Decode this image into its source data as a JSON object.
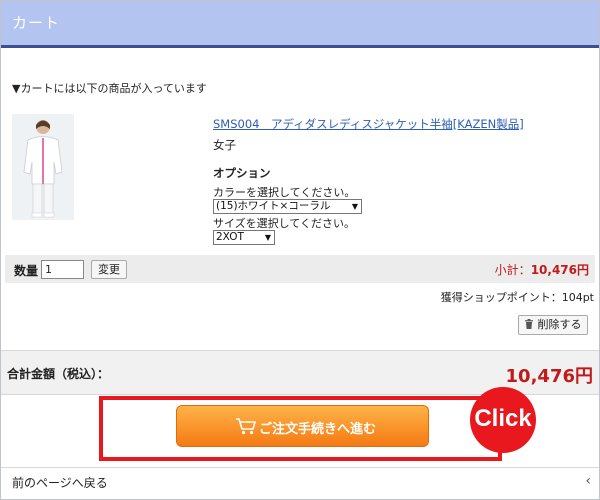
{
  "header": {
    "title": "カート"
  },
  "cart": {
    "intro": "▼カートには以下の商品が入っています",
    "item": {
      "name": "SMS004　アディダスレディスジャケット半袖[KAZEN製品]",
      "gender": "女子",
      "options_title": "オプション",
      "color_label": "カラーを選択してください。",
      "color_value": "(15)ホワイト×コーラル",
      "size_label": "サイズを選択してください。",
      "size_value": "2XOT",
      "image_icon": "product-photo"
    },
    "quantity": {
      "label": "数量",
      "value": "1",
      "change_label": "変更"
    },
    "subtotal": {
      "label": "小計：",
      "value": "10,476円"
    },
    "points": "獲得ショップポイント：104pt",
    "delete_label": "削除する"
  },
  "total": {
    "label": "合計金額（税込）：",
    "value": "10,476円"
  },
  "checkout": {
    "label": "ご注文手続きへ進む",
    "icon": "cart-icon"
  },
  "callout": {
    "text": "Click"
  },
  "footer": {
    "back_label": "前のページへ戻る",
    "chevron": "‹"
  },
  "colors": {
    "header_bg": "#b3c4f1",
    "header_rule": "#3c4f8f",
    "price_red": "#c21a1a",
    "checkout_orange": "#f47a14",
    "highlight_red": "#e8181e"
  }
}
